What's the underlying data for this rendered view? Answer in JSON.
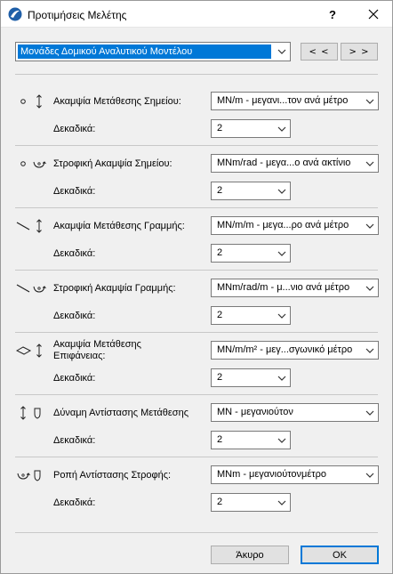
{
  "window": {
    "title": "Προτιμήσεις Μελέτης",
    "help_label": "?"
  },
  "top": {
    "category_select": "Μονάδες Δομικού Αναλυτικού Μοντέλου",
    "prev_label": "< <",
    "next_label": "> >"
  },
  "rows": [
    {
      "label": "Ακαμψία Μετάθεσης Σημείου:",
      "unit": "MN/m - μεγανι...τον ανά μέτρο",
      "decimals_label": "Δεκαδικά:",
      "decimals": "2",
      "icons": [
        "point-icon",
        "translation-arrow-icon"
      ]
    },
    {
      "label": "Στροφική Ακαμψία Σημείου:",
      "unit": "MNm/rad - μεγα...ο ανά ακτίνιο",
      "decimals_label": "Δεκαδικά:",
      "decimals": "2",
      "icons": [
        "point-icon",
        "rotation-arrow-icon"
      ]
    },
    {
      "label": "Ακαμψία Μετάθεσης Γραμμής:",
      "unit": "MN/m/m - μεγα...ρο ανά μέτρο",
      "decimals_label": "Δεκαδικά:",
      "decimals": "2",
      "icons": [
        "line-icon",
        "translation-arrow-icon"
      ]
    },
    {
      "label": "Στροφική Ακαμψία Γραμμής:",
      "unit": "MNm/rad/m - μ...νιο ανά μέτρο",
      "decimals_label": "Δεκαδικά:",
      "decimals": "2",
      "icons": [
        "line-icon",
        "rotation-arrow-icon"
      ]
    },
    {
      "label": "Ακαμψία Μετάθεσης Επιφάνειας:",
      "unit": "MN/m/m² - μεγ...σγωνικό μέτρο",
      "decimals_label": "Δεκαδικά:",
      "decimals": "2",
      "icons": [
        "surface-icon",
        "translation-arrow-icon"
      ]
    },
    {
      "label": "Δύναμη Αντίστασης Μετάθεσης",
      "unit": "MN - μεγανιούτον",
      "decimals_label": "Δεκαδικά:",
      "decimals": "2",
      "icons": [
        "translation-arrow-icon",
        "resistance-shield-icon"
      ]
    },
    {
      "label": "Ροπή Αντίστασης Στροφής:",
      "unit": "MNm - μεγανιούτονμέτρο",
      "decimals_label": "Δεκαδικά:",
      "decimals": "2",
      "icons": [
        "rotation-arrow-icon",
        "resistance-shield-icon"
      ]
    }
  ],
  "footer": {
    "cancel_label": "Άκυρο",
    "ok_label": "OK"
  },
  "colors": {
    "selection": "#0078d7",
    "background": "#f0f0f0"
  }
}
